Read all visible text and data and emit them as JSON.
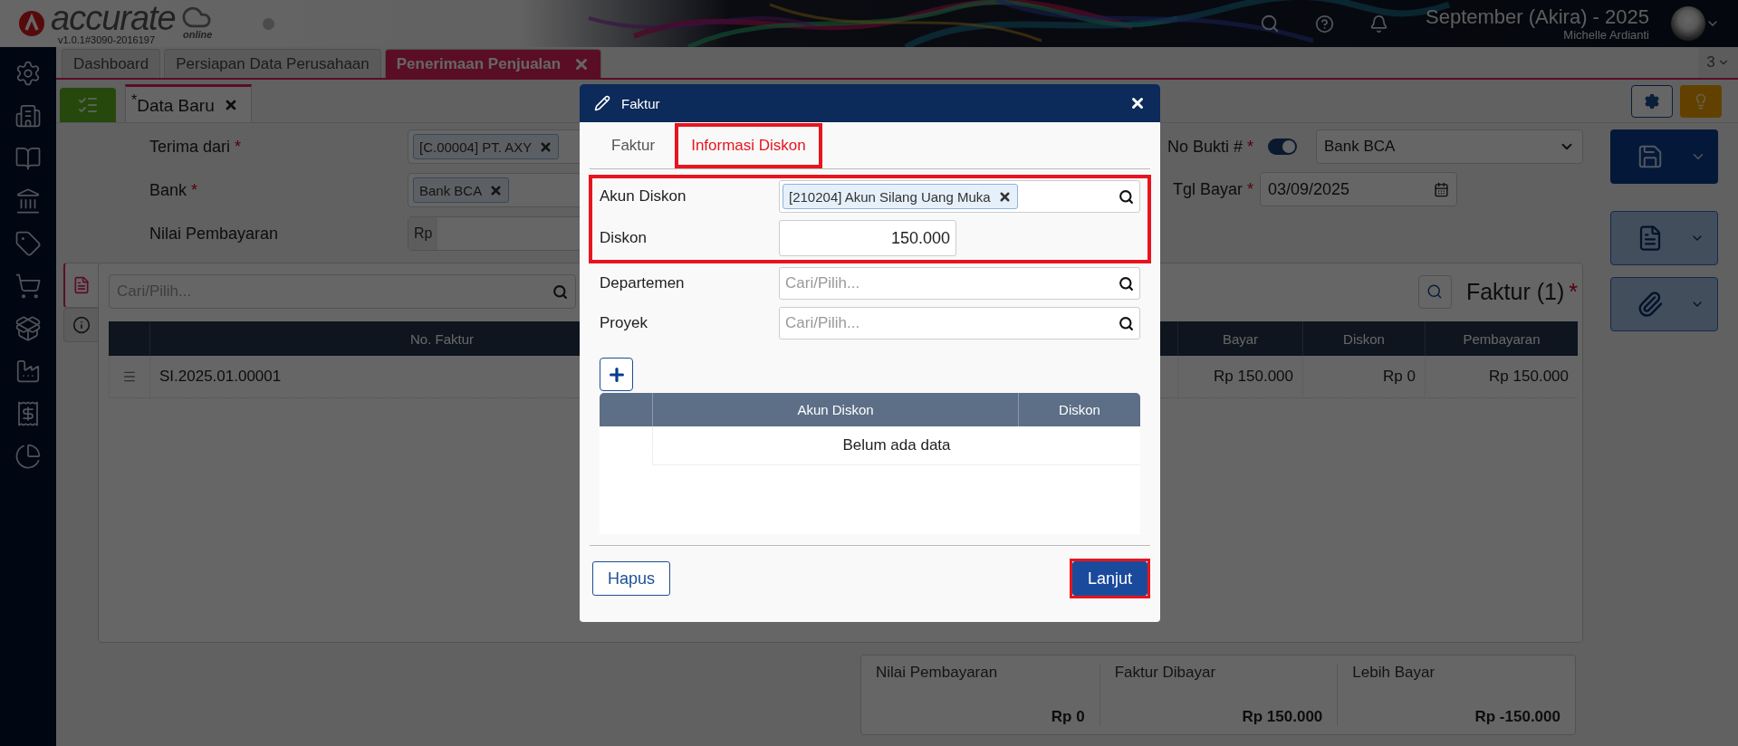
{
  "header": {
    "brand": {
      "name": "accurate",
      "suffix": "online",
      "version": "v1.0.1#3090-2016197"
    },
    "period": "September (Akira) - 2025",
    "user": "Michelle Ardianti"
  },
  "tabs": [
    {
      "label": "Dashboard",
      "selected": false
    },
    {
      "label": "Persiapan Data Perusahaan",
      "selected": false
    },
    {
      "label": "Penerimaan Penjualan",
      "selected": true
    }
  ],
  "tab_count": "3",
  "subtabs": [
    {
      "label": "$^{*}$Data Baru"
    }
  ],
  "form": {
    "fields": [
      {
        "label": "Terima dari",
        "mark": "*",
        "kind": "chip",
        "value": "[C.00004] PT. AXY"
      },
      {
        "label": "Bank",
        "mark": "*",
        "kind": "chip",
        "value": "Bank BCA"
      },
      {
        "label": "Nilai Pembayaran",
        "kind": "money",
        "prefix": "Rp"
      }
    ],
    "no_bukti": {
      "label": "No Bukti #",
      "mark": "*",
      "on": true,
      "value": "Bank BCA"
    },
    "tgl_bayar": {
      "label": "Tgl Bayar",
      "mark": "*",
      "value": "03/09/2025"
    }
  },
  "invoices": {
    "search_placeholder": "Cari/Pilih...",
    "title": "Faktur (1)",
    "title_mark": "*",
    "columns": [
      "No. Faktur",
      "Bayar",
      "Diskon",
      "Pembayaran"
    ],
    "rows": [
      {
        "no": "SI.2025.01.00001",
        "bayar": "Rp 150.000",
        "diskon": "Rp 0",
        "pembayaran": "Rp 150.000"
      }
    ]
  },
  "summary": [
    {
      "label": "Nilai Pembayaran",
      "value": "Rp 0"
    },
    {
      "label": "Faktur Dibayar",
      "value": "Rp 150.000"
    },
    {
      "label": "Lebih Bayar",
      "value": "Rp -150.000"
    }
  ],
  "dialog": {
    "title": "Faktur",
    "tabs": [
      {
        "label": "Faktur",
        "selected": false,
        "highlighted": false
      },
      {
        "label": "Informasi Diskon",
        "selected": true,
        "highlighted": true
      }
    ],
    "fields": [
      {
        "label": "Akun Diskon",
        "kind": "chip",
        "value": "[210204] Akun Silang Uang Muka",
        "highlighted": true
      },
      {
        "label": "Diskon",
        "kind": "number",
        "value": "150.000",
        "highlighted": true
      },
      {
        "label": "Departemen",
        "kind": "search",
        "placeholder": "Cari/Pilih...",
        "highlighted": false
      },
      {
        "label": "Proyek",
        "kind": "search",
        "placeholder": "Cari/Pilih...",
        "highlighted": false
      }
    ],
    "table": {
      "columns": [
        "Akun Diskon",
        "Diskon"
      ],
      "empty_text": "Belum ada data"
    },
    "buttons": [
      {
        "label": "Hapus",
        "kind": "secondary",
        "highlighted": false
      },
      {
        "label": "Lanjut",
        "kind": "primary",
        "highlighted": true
      }
    ]
  }
}
